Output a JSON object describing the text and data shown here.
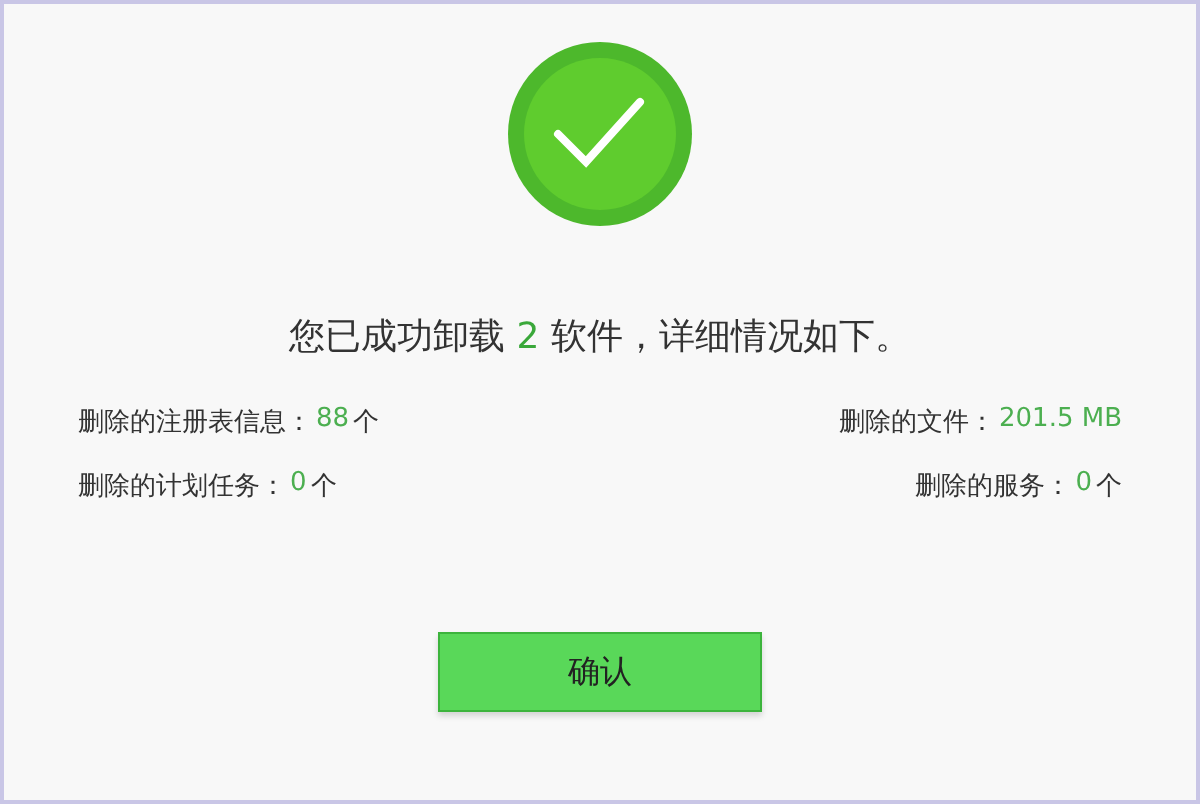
{
  "headline": {
    "before": "您已成功卸载",
    "count": "2",
    "after": "软件，详细情况如下。"
  },
  "stats": [
    {
      "label": "删除的注册表信息：",
      "value": "88",
      "unit": "个"
    },
    {
      "label": "删除的文件：",
      "value": "201.5 MB"
    },
    {
      "label": "删除的计划任务：",
      "value": "0",
      "unit": "个"
    },
    {
      "label": "删除的服务：",
      "value": "0",
      "unit": "个"
    }
  ],
  "confirm_button": "确认"
}
